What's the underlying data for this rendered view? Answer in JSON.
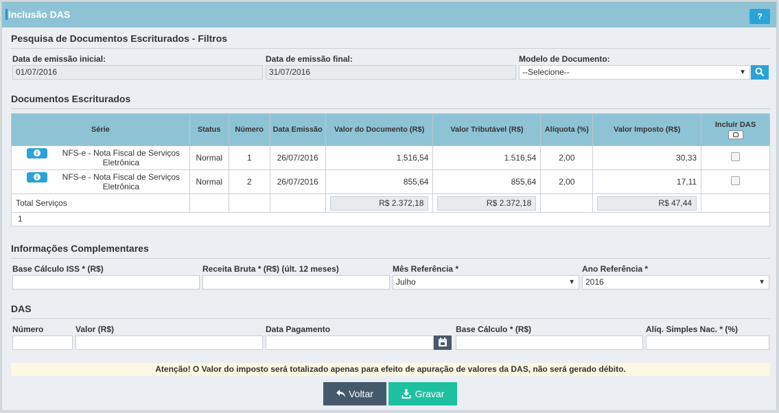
{
  "header": {
    "title": "Inclusão DAS",
    "help_label": "?"
  },
  "filters": {
    "section_title": "Pesquisa de Documentos Escriturados - Filtros",
    "start_label": "Data de emissão inicial:",
    "start_value": "01/07/2016",
    "end_label": "Data de emissão final:",
    "end_value": "31/07/2016",
    "model_label": "Modelo de Documento:",
    "model_value": "--Selecione--"
  },
  "docs": {
    "section_title": "Documentos Escriturados",
    "columns": [
      "Série",
      "Status",
      "Número",
      "Data Emissão",
      "Valor do Documento (R$)",
      "Valor Tributável (R$)",
      "Alíquota (%)",
      "Valor Imposto (R$)",
      "Incluir DAS"
    ],
    "rows": [
      {
        "serie": "NFS-e - Nota Fiscal de Serviços Eletrônica",
        "status": "Normal",
        "numero": "1",
        "data": "26/07/2016",
        "valor_doc": "1.516,54",
        "valor_trib": "1.516,54",
        "aliquota": "2,00",
        "valor_imposto": "30,33"
      },
      {
        "serie": "NFS-e - Nota Fiscal de Serviços Eletrônica",
        "status": "Normal",
        "numero": "2",
        "data": "26/07/2016",
        "valor_doc": "855,64",
        "valor_trib": "855,64",
        "aliquota": "2,00",
        "valor_imposto": "17,11"
      }
    ],
    "totals": {
      "label": "Total Serviços",
      "valor_doc": "R$ 2.372,18",
      "valor_trib": "R$ 2.372,18",
      "valor_imposto": "R$ 47,44"
    },
    "page": "1"
  },
  "complementares": {
    "section_title": "Informações Complementares",
    "base_label": "Base Cálculo ISS * (R$)",
    "receita_label": "Receita Bruta * (R$) (últ. 12 meses)",
    "mes_label": "Mês Referência *",
    "mes_value": "Julho",
    "ano_label": "Ano Referência *",
    "ano_value": "2016"
  },
  "das": {
    "section_title": "DAS",
    "numero_label": "Número",
    "valor_label": "Valor (R$)",
    "data_label": "Data Pagamento",
    "base_label": "Base Cálculo * (R$)",
    "aliq_label": "Alíq. Simples Nac. * (%)"
  },
  "warning": "Atenção! O Valor do imposto será totalizado apenas para efeito de apuração de valores da DAS, não será gerado débito.",
  "buttons": {
    "back": "Voltar",
    "save": "Gravar"
  },
  "colors": {
    "header": "#8ec3d5",
    "accent": "#2ba3d8",
    "save": "#1ec0a0",
    "back": "#45596c"
  }
}
